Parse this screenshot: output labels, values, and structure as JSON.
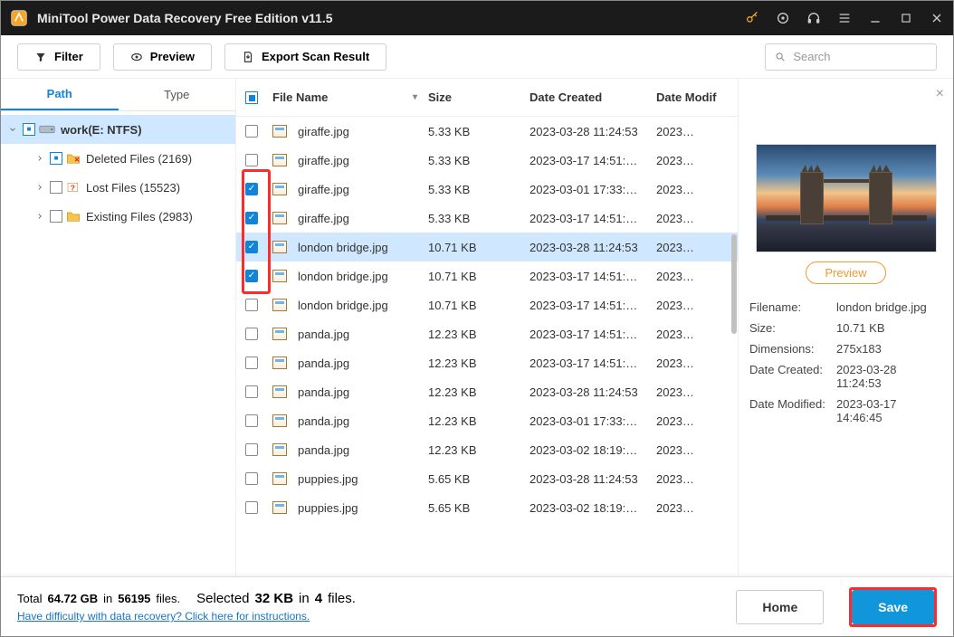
{
  "titlebar": {
    "title": "MiniTool Power Data Recovery Free Edition v11.5"
  },
  "toolbar": {
    "filter": "Filter",
    "preview": "Preview",
    "export": "Export Scan Result",
    "search_placeholder": "Search"
  },
  "nav": {
    "path_tab": "Path",
    "type_tab": "Type"
  },
  "tree": {
    "root": "work(E: NTFS)",
    "items": [
      {
        "label": "Deleted Files (2169)"
      },
      {
        "label": "Lost Files (15523)"
      },
      {
        "label": "Existing Files (2983)"
      }
    ]
  },
  "columns": {
    "filename": "File Name",
    "size": "Size",
    "date_created": "Date Created",
    "date_modified": "Date Modif"
  },
  "rows": [
    {
      "checked": false,
      "name": "giraffe.jpg",
      "size": "5.33 KB",
      "created": "2023-03-28 11:24:53",
      "modified": "2023…",
      "selected": false
    },
    {
      "checked": false,
      "name": "giraffe.jpg",
      "size": "5.33 KB",
      "created": "2023-03-17 14:51:…",
      "modified": "2023…",
      "selected": false
    },
    {
      "checked": true,
      "name": "giraffe.jpg",
      "size": "5.33 KB",
      "created": "2023-03-01 17:33:…",
      "modified": "2023…",
      "selected": false
    },
    {
      "checked": true,
      "name": "giraffe.jpg",
      "size": "5.33 KB",
      "created": "2023-03-17 14:51:…",
      "modified": "2023…",
      "selected": false
    },
    {
      "checked": true,
      "name": "london bridge.jpg",
      "size": "10.71 KB",
      "created": "2023-03-28 11:24:53",
      "modified": "2023…",
      "selected": true
    },
    {
      "checked": true,
      "name": "london bridge.jpg",
      "size": "10.71 KB",
      "created": "2023-03-17 14:51:…",
      "modified": "2023…",
      "selected": false
    },
    {
      "checked": false,
      "name": "london bridge.jpg",
      "size": "10.71 KB",
      "created": "2023-03-17 14:51:…",
      "modified": "2023…",
      "selected": false
    },
    {
      "checked": false,
      "name": "panda.jpg",
      "size": "12.23 KB",
      "created": "2023-03-17 14:51:…",
      "modified": "2023…",
      "selected": false
    },
    {
      "checked": false,
      "name": "panda.jpg",
      "size": "12.23 KB",
      "created": "2023-03-17 14:51:…",
      "modified": "2023…",
      "selected": false
    },
    {
      "checked": false,
      "name": "panda.jpg",
      "size": "12.23 KB",
      "created": "2023-03-28 11:24:53",
      "modified": "2023…",
      "selected": false
    },
    {
      "checked": false,
      "name": "panda.jpg",
      "size": "12.23 KB",
      "created": "2023-03-01 17:33:…",
      "modified": "2023…",
      "selected": false
    },
    {
      "checked": false,
      "name": "panda.jpg",
      "size": "12.23 KB",
      "created": "2023-03-02 18:19:…",
      "modified": "2023…",
      "selected": false
    },
    {
      "checked": false,
      "name": "puppies.jpg",
      "size": "5.65 KB",
      "created": "2023-03-28 11:24:53",
      "modified": "2023…",
      "selected": false
    },
    {
      "checked": false,
      "name": "puppies.jpg",
      "size": "5.65 KB",
      "created": "2023-03-02 18:19:…",
      "modified": "2023…",
      "selected": false
    }
  ],
  "preview": {
    "button": "Preview",
    "meta": [
      {
        "k": "Filename:",
        "v": "london bridge.jpg"
      },
      {
        "k": "Size:",
        "v": "10.71 KB"
      },
      {
        "k": "Dimensions:",
        "v": "275x183"
      },
      {
        "k": "Date Created:",
        "v": "2023-03-28 11:24:53"
      },
      {
        "k": "Date Modified:",
        "v": "2023-03-17 14:46:45"
      }
    ]
  },
  "status": {
    "total_prefix": "Total",
    "total_size": "64.72 GB",
    "total_mid": "in",
    "total_files": "56195",
    "total_suffix": "files.",
    "sel_prefix": "Selected",
    "sel_size": "32 KB",
    "sel_mid": "in",
    "sel_count": "4",
    "sel_suffix": "files.",
    "help_link": "Have difficulty with data recovery? Click here for instructions."
  },
  "footer": {
    "home": "Home",
    "save": "Save"
  }
}
